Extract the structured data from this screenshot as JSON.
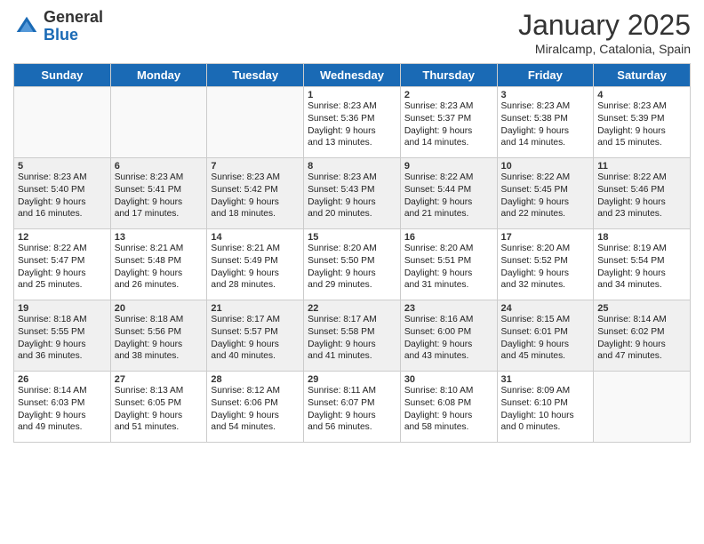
{
  "header": {
    "logo_general": "General",
    "logo_blue": "Blue",
    "title": "January 2025",
    "location": "Miralcamp, Catalonia, Spain"
  },
  "days_of_week": [
    "Sunday",
    "Monday",
    "Tuesday",
    "Wednesday",
    "Thursday",
    "Friday",
    "Saturday"
  ],
  "weeks": [
    [
      {
        "day": "",
        "info": ""
      },
      {
        "day": "",
        "info": ""
      },
      {
        "day": "",
        "info": ""
      },
      {
        "day": "1",
        "info": "Sunrise: 8:23 AM\nSunset: 5:36 PM\nDaylight: 9 hours\nand 13 minutes."
      },
      {
        "day": "2",
        "info": "Sunrise: 8:23 AM\nSunset: 5:37 PM\nDaylight: 9 hours\nand 14 minutes."
      },
      {
        "day": "3",
        "info": "Sunrise: 8:23 AM\nSunset: 5:38 PM\nDaylight: 9 hours\nand 14 minutes."
      },
      {
        "day": "4",
        "info": "Sunrise: 8:23 AM\nSunset: 5:39 PM\nDaylight: 9 hours\nand 15 minutes."
      }
    ],
    [
      {
        "day": "5",
        "info": "Sunrise: 8:23 AM\nSunset: 5:40 PM\nDaylight: 9 hours\nand 16 minutes."
      },
      {
        "day": "6",
        "info": "Sunrise: 8:23 AM\nSunset: 5:41 PM\nDaylight: 9 hours\nand 17 minutes."
      },
      {
        "day": "7",
        "info": "Sunrise: 8:23 AM\nSunset: 5:42 PM\nDaylight: 9 hours\nand 18 minutes."
      },
      {
        "day": "8",
        "info": "Sunrise: 8:23 AM\nSunset: 5:43 PM\nDaylight: 9 hours\nand 20 minutes."
      },
      {
        "day": "9",
        "info": "Sunrise: 8:22 AM\nSunset: 5:44 PM\nDaylight: 9 hours\nand 21 minutes."
      },
      {
        "day": "10",
        "info": "Sunrise: 8:22 AM\nSunset: 5:45 PM\nDaylight: 9 hours\nand 22 minutes."
      },
      {
        "day": "11",
        "info": "Sunrise: 8:22 AM\nSunset: 5:46 PM\nDaylight: 9 hours\nand 23 minutes."
      }
    ],
    [
      {
        "day": "12",
        "info": "Sunrise: 8:22 AM\nSunset: 5:47 PM\nDaylight: 9 hours\nand 25 minutes."
      },
      {
        "day": "13",
        "info": "Sunrise: 8:21 AM\nSunset: 5:48 PM\nDaylight: 9 hours\nand 26 minutes."
      },
      {
        "day": "14",
        "info": "Sunrise: 8:21 AM\nSunset: 5:49 PM\nDaylight: 9 hours\nand 28 minutes."
      },
      {
        "day": "15",
        "info": "Sunrise: 8:20 AM\nSunset: 5:50 PM\nDaylight: 9 hours\nand 29 minutes."
      },
      {
        "day": "16",
        "info": "Sunrise: 8:20 AM\nSunset: 5:51 PM\nDaylight: 9 hours\nand 31 minutes."
      },
      {
        "day": "17",
        "info": "Sunrise: 8:20 AM\nSunset: 5:52 PM\nDaylight: 9 hours\nand 32 minutes."
      },
      {
        "day": "18",
        "info": "Sunrise: 8:19 AM\nSunset: 5:54 PM\nDaylight: 9 hours\nand 34 minutes."
      }
    ],
    [
      {
        "day": "19",
        "info": "Sunrise: 8:18 AM\nSunset: 5:55 PM\nDaylight: 9 hours\nand 36 minutes."
      },
      {
        "day": "20",
        "info": "Sunrise: 8:18 AM\nSunset: 5:56 PM\nDaylight: 9 hours\nand 38 minutes."
      },
      {
        "day": "21",
        "info": "Sunrise: 8:17 AM\nSunset: 5:57 PM\nDaylight: 9 hours\nand 40 minutes."
      },
      {
        "day": "22",
        "info": "Sunrise: 8:17 AM\nSunset: 5:58 PM\nDaylight: 9 hours\nand 41 minutes."
      },
      {
        "day": "23",
        "info": "Sunrise: 8:16 AM\nSunset: 6:00 PM\nDaylight: 9 hours\nand 43 minutes."
      },
      {
        "day": "24",
        "info": "Sunrise: 8:15 AM\nSunset: 6:01 PM\nDaylight: 9 hours\nand 45 minutes."
      },
      {
        "day": "25",
        "info": "Sunrise: 8:14 AM\nSunset: 6:02 PM\nDaylight: 9 hours\nand 47 minutes."
      }
    ],
    [
      {
        "day": "26",
        "info": "Sunrise: 8:14 AM\nSunset: 6:03 PM\nDaylight: 9 hours\nand 49 minutes."
      },
      {
        "day": "27",
        "info": "Sunrise: 8:13 AM\nSunset: 6:05 PM\nDaylight: 9 hours\nand 51 minutes."
      },
      {
        "day": "28",
        "info": "Sunrise: 8:12 AM\nSunset: 6:06 PM\nDaylight: 9 hours\nand 54 minutes."
      },
      {
        "day": "29",
        "info": "Sunrise: 8:11 AM\nSunset: 6:07 PM\nDaylight: 9 hours\nand 56 minutes."
      },
      {
        "day": "30",
        "info": "Sunrise: 8:10 AM\nSunset: 6:08 PM\nDaylight: 9 hours\nand 58 minutes."
      },
      {
        "day": "31",
        "info": "Sunrise: 8:09 AM\nSunset: 6:10 PM\nDaylight: 10 hours\nand 0 minutes."
      },
      {
        "day": "",
        "info": ""
      }
    ]
  ]
}
